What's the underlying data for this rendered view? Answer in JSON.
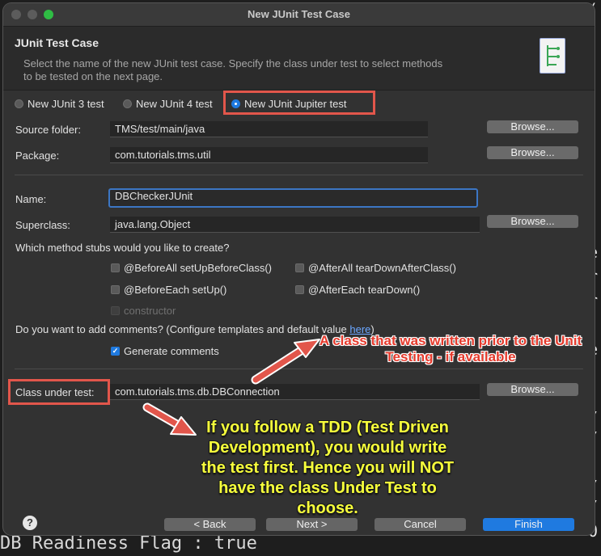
{
  "window": {
    "title": "New JUnit Test Case"
  },
  "header": {
    "title": "JUnit Test Case",
    "description": "Select the name of the new JUnit test case. Specify the class under test to select methods to be tested on the next page."
  },
  "junit_versions": [
    {
      "label": "New JUnit 3 test",
      "selected": false
    },
    {
      "label": "New JUnit 4 test",
      "selected": false
    },
    {
      "label": "New JUnit Jupiter test",
      "selected": true
    }
  ],
  "form": {
    "source_folder_label": "Source folder:",
    "source_folder_value": "TMS/test/main/java",
    "package_label": "Package:",
    "package_value": "com.tutorials.tms.util",
    "name_label": "Name:",
    "name_value": "DBCheckerJUnit",
    "superclass_label": "Superclass:",
    "superclass_value": "java.lang.Object",
    "browse_label": "Browse...",
    "stubs_question": "Which method stubs would you like to create?",
    "stubs": [
      {
        "label": "@BeforeAll setUpBeforeClass()",
        "checked": false
      },
      {
        "label": "@AfterAll tearDownAfterClass()",
        "checked": false
      },
      {
        "label": "@BeforeEach setUp()",
        "checked": false
      },
      {
        "label": "@AfterEach tearDown()",
        "checked": false
      },
      {
        "label": "constructor",
        "checked": false,
        "disabled": true
      }
    ],
    "comments_question_prefix": "Do you want to add comments? (Configure templates and default value ",
    "comments_link": "here",
    "comments_question_suffix": ")",
    "generate_comments_label": "Generate comments",
    "generate_comments_checked": true,
    "class_under_test_label": "Class under test:",
    "class_under_test_value": "com.tutorials.tms.db.DBConnection"
  },
  "footer": {
    "help_symbol": "?",
    "back_label": "< Back",
    "next_label": "Next >",
    "cancel_label": "Cancel",
    "finish_label": "Finish"
  },
  "annotations": {
    "red_note": "A class that was written prior to the Unit Testing - if available",
    "yellow_note": "If you follow a TDD (Test Driven Development), you would write the test first. Hence you will NOT have the class Under Test to choose."
  },
  "background_code": {
    "bottom_text": "DB Readiness Flag : true",
    "right_chars": [
      "(",
      "e",
      "r",
      "r",
      "e",
      ";",
      "/",
      "/",
      "/",
      "/",
      "0"
    ]
  },
  "colors": {
    "accent": "#1f7ae0",
    "highlight_box": "#e2564b",
    "annotation_red": "#e53a2c",
    "annotation_yellow": "#f7ff3b"
  }
}
